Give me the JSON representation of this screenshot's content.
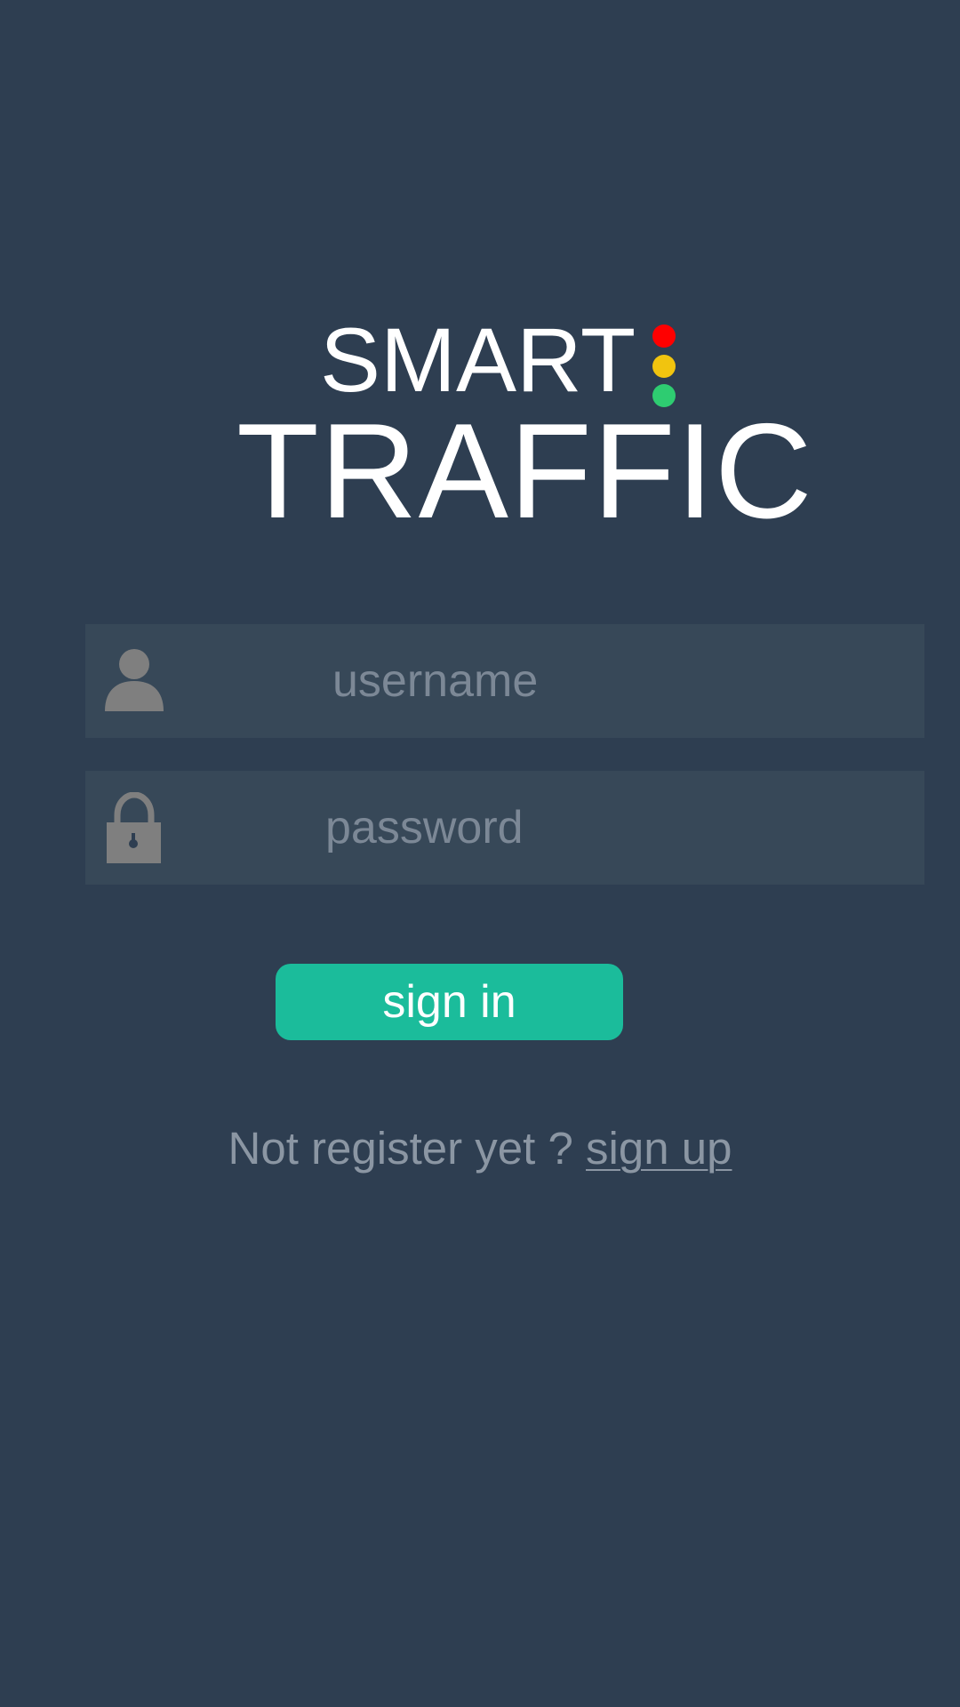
{
  "logo": {
    "line1": "SMART",
    "line2": "TRAFFIC",
    "lights": [
      "#ff0000",
      "#f1c40f",
      "#2ecc71"
    ]
  },
  "form": {
    "username": {
      "icon": "user-icon",
      "placeholder": "username",
      "value": ""
    },
    "password": {
      "icon": "lock-icon",
      "placeholder": "password",
      "value": ""
    },
    "submit_label": "sign in"
  },
  "footer": {
    "prompt": "Not register yet ? ",
    "link_label": "sign up"
  },
  "colors": {
    "background": "#2e3e51",
    "field": "#374858",
    "accent": "#1bbc9b",
    "muted_text": "#8b96a3",
    "icon": "#7f7f7f"
  }
}
